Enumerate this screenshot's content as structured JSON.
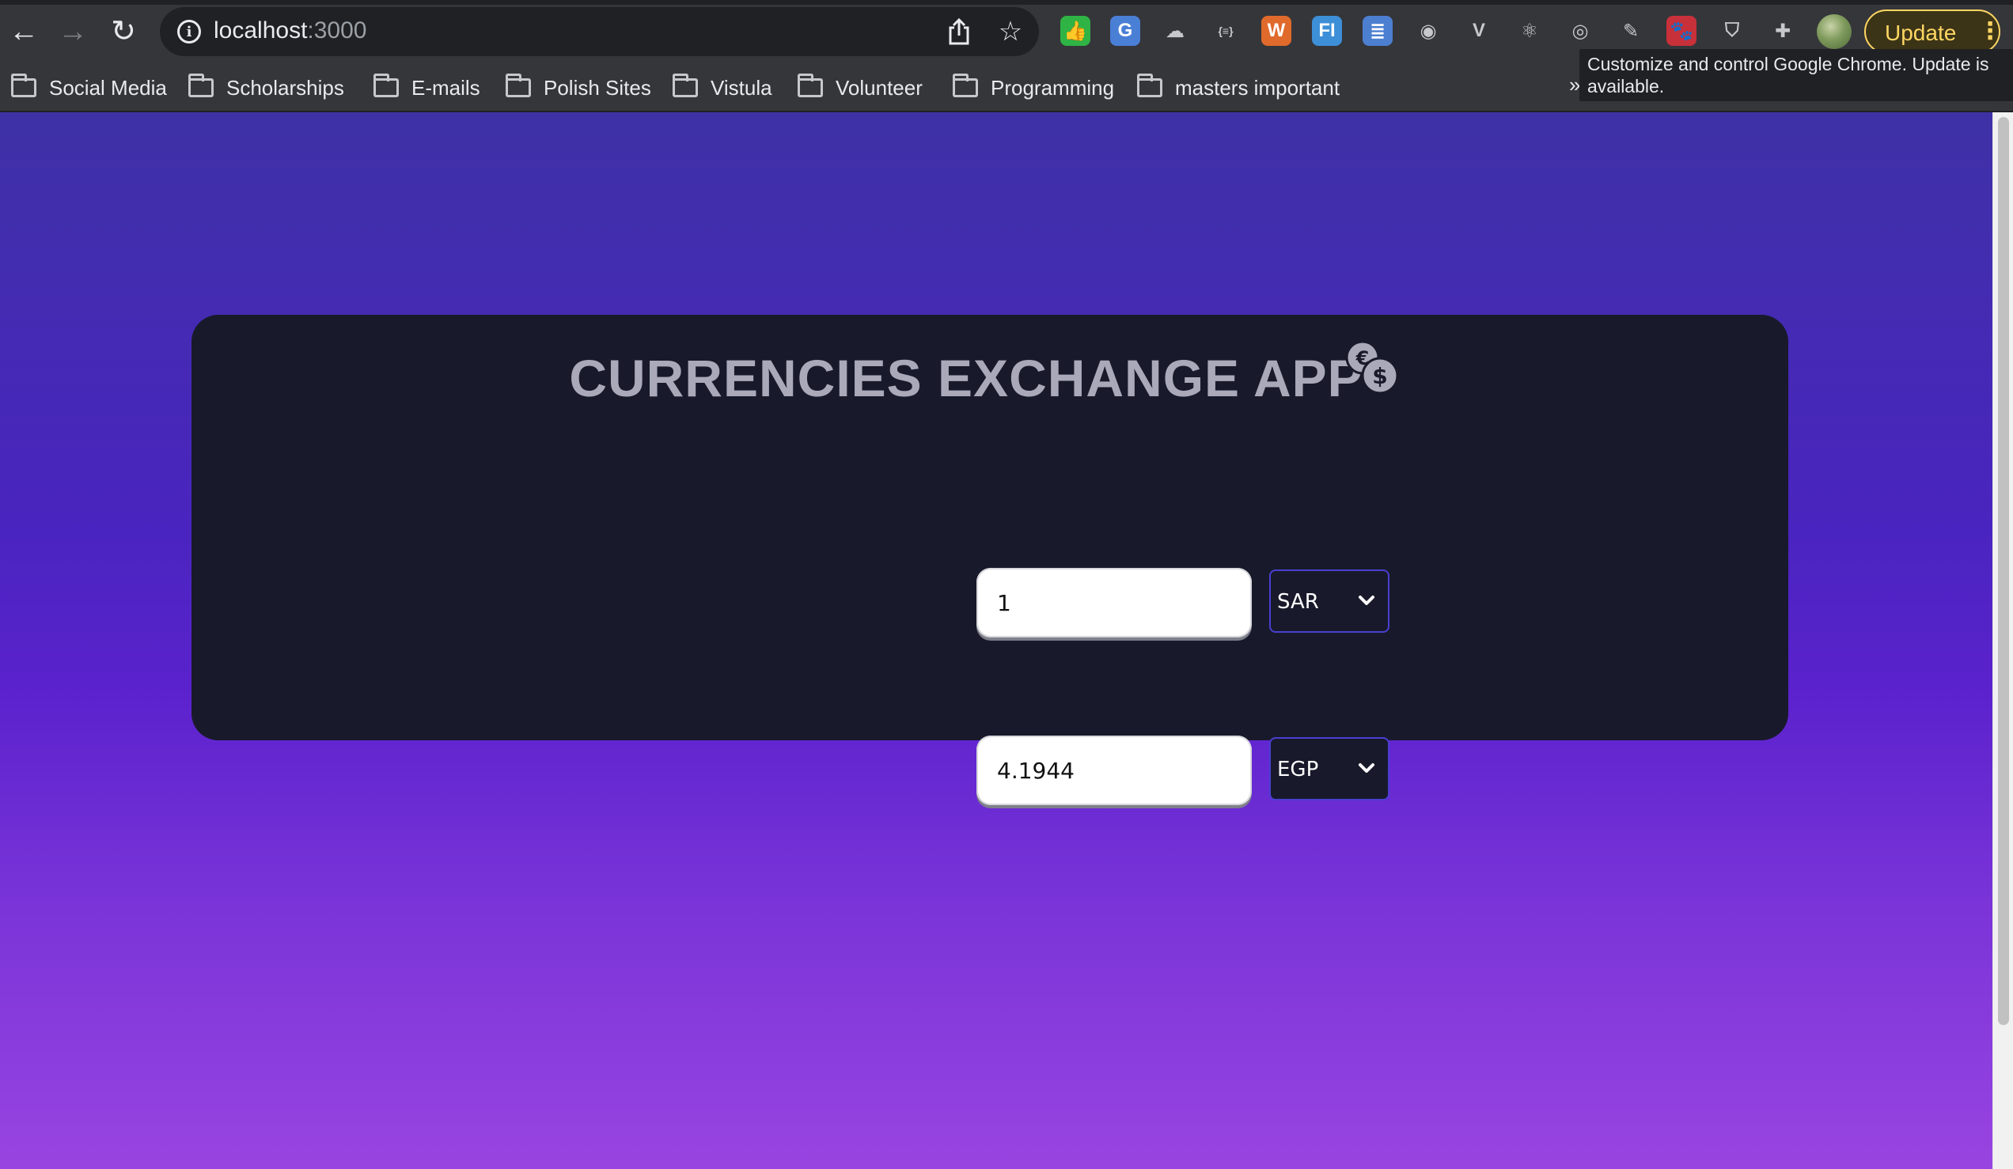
{
  "browser": {
    "url_host": "localhost",
    "url_port": ":3000",
    "update_label": "Update",
    "tooltip": "Customize and control Google Chrome. Update is available.",
    "bookmarks": [
      {
        "label": "Social Media"
      },
      {
        "label": "Scholarships"
      },
      {
        "label": "E-mails"
      },
      {
        "label": "Polish Sites"
      },
      {
        "label": "Vistula"
      },
      {
        "label": "Volunteer"
      },
      {
        "label": "Programming"
      },
      {
        "label": "masters important"
      }
    ],
    "overflow_label": "»",
    "extensions": [
      {
        "name": "thumbs-up-extension-icon",
        "color": "#2fb344",
        "glyph": "👍"
      },
      {
        "name": "google-translate-extension-icon",
        "color": "#4a7fd6",
        "glyph": "G"
      },
      {
        "name": "cloud-extension-icon",
        "color": "#35363a",
        "glyph": "☁"
      },
      {
        "name": "json-extension-icon",
        "color": "#35363a",
        "glyph": "{≡}"
      },
      {
        "name": "dictionary-extension-icon",
        "color": "#e06a2b",
        "glyph": "W"
      },
      {
        "name": "fi-extension-icon",
        "color": "#3d8fd8",
        "glyph": "FI"
      },
      {
        "name": "document-extension-icon",
        "color": "#4c7fd0",
        "glyph": "≣"
      },
      {
        "name": "camera-extension-icon",
        "color": "#35363a",
        "glyph": "◉"
      },
      {
        "name": "vue-extension-icon",
        "color": "#35363a",
        "glyph": "V"
      },
      {
        "name": "react-extension-icon",
        "color": "#35363a",
        "glyph": "⚛"
      },
      {
        "name": "target-extension-icon",
        "color": "#35363a",
        "glyph": "◎"
      },
      {
        "name": "pen-extension-icon",
        "color": "#35363a",
        "glyph": "✎"
      },
      {
        "name": "paw-extension-icon",
        "color": "#c8303a",
        "glyph": "🐾"
      },
      {
        "name": "shield-extension-icon",
        "color": "#35363a",
        "glyph": "⛉"
      },
      {
        "name": "puzzle-extension-icon",
        "color": "#35363a",
        "glyph": "✚"
      }
    ]
  },
  "app": {
    "title": "CURRENCIES EXCHANGE APP",
    "from": {
      "amount": "1",
      "currency": "SAR"
    },
    "to": {
      "amount": "4.1944",
      "currency": "EGP"
    }
  },
  "colors": {
    "card_bg": "#181a2b",
    "title_color": "#a9a9b9",
    "select_border": "#4a3fd1",
    "gradient_top": "#3e31a6",
    "gradient_bottom": "#9844e1"
  }
}
